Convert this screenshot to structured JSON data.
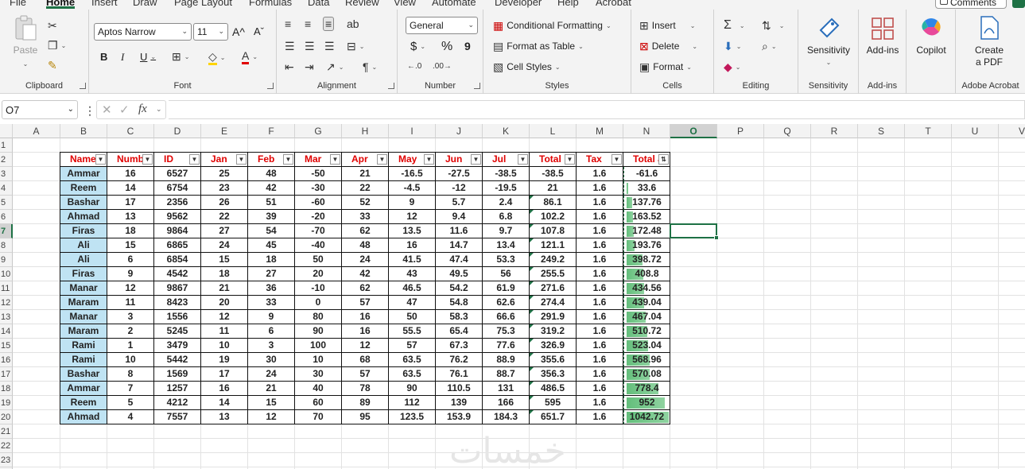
{
  "menu": {
    "tabs": [
      "File",
      "Home",
      "Insert",
      "Draw",
      "Page Layout",
      "Formulas",
      "Data",
      "Review",
      "View",
      "Automate",
      "Developer",
      "Help",
      "Acrobat"
    ],
    "active": "Home",
    "comments_label": "Comments"
  },
  "ribbon": {
    "clipboard": {
      "label": "Clipboard",
      "paste": "Paste"
    },
    "font": {
      "label": "Font",
      "family": "Aptos Narrow",
      "size": "11",
      "bold": "B",
      "italic": "I",
      "underline": "U",
      "grow": "A^",
      "shrink": "Aˇ"
    },
    "alignment": {
      "label": "Alignment"
    },
    "number": {
      "label": "Number",
      "format": "General",
      "currency": "$",
      "percent": "%",
      "comma": "9"
    },
    "styles": {
      "label": "Styles",
      "conditional": "Conditional Formatting",
      "format_table": "Format as Table",
      "cell_styles": "Cell Styles"
    },
    "cells": {
      "label": "Cells",
      "insert": "Insert",
      "delete": "Delete",
      "format": "Format"
    },
    "editing": {
      "label": "Editing"
    },
    "sensitivity": {
      "label": "Sensitivity",
      "button": "Sensitivity"
    },
    "addins": {
      "label": "Add-ins",
      "button": "Add-ins"
    },
    "copilot": {
      "button": "Copilot"
    },
    "acrobat": {
      "label": "Adobe Acrobat",
      "button_line1": "Create",
      "button_line2": "a PDF"
    }
  },
  "formula_bar": {
    "name_box": "O7",
    "fx": "fx",
    "content": ""
  },
  "columns": [
    "A",
    "B",
    "C",
    "D",
    "E",
    "F",
    "G",
    "H",
    "I",
    "J",
    "K",
    "L",
    "M",
    "N",
    "O",
    "P",
    "Q",
    "R",
    "S",
    "T",
    "U",
    "V"
  ],
  "selected_column": "O",
  "selected_row": 7,
  "table": {
    "headers": [
      "Name",
      "Numb",
      "ID",
      "Jan",
      "Feb",
      "Mar",
      "Apr",
      "May",
      "Jun",
      "Jul",
      "Total",
      "Tax",
      "Total af"
    ],
    "rows": [
      [
        "Ammar",
        "16",
        "6527",
        "25",
        "48",
        "-50",
        "21",
        "-16.5",
        "-27.5",
        "-38.5",
        "-38.5",
        "1.6",
        "-61.6"
      ],
      [
        "Reem",
        "14",
        "6754",
        "23",
        "42",
        "-30",
        "22",
        "-4.5",
        "-12",
        "-19.5",
        "21",
        "1.6",
        "33.6"
      ],
      [
        "Bashar",
        "17",
        "2356",
        "26",
        "51",
        "-60",
        "52",
        "9",
        "5.7",
        "2.4",
        "86.1",
        "1.6",
        "137.76"
      ],
      [
        "Ahmad",
        "13",
        "9562",
        "22",
        "39",
        "-20",
        "33",
        "12",
        "9.4",
        "6.8",
        "102.2",
        "1.6",
        "163.52"
      ],
      [
        "Firas",
        "18",
        "9864",
        "27",
        "54",
        "-70",
        "62",
        "13.5",
        "11.6",
        "9.7",
        "107.8",
        "1.6",
        "172.48"
      ],
      [
        "Ali",
        "15",
        "6865",
        "24",
        "45",
        "-40",
        "48",
        "16",
        "14.7",
        "13.4",
        "121.1",
        "1.6",
        "193.76"
      ],
      [
        "Ali",
        "6",
        "6854",
        "15",
        "18",
        "50",
        "24",
        "41.5",
        "47.4",
        "53.3",
        "249.2",
        "1.6",
        "398.72"
      ],
      [
        "Firas",
        "9",
        "4542",
        "18",
        "27",
        "20",
        "42",
        "43",
        "49.5",
        "56",
        "255.5",
        "1.6",
        "408.8"
      ],
      [
        "Manar",
        "12",
        "9867",
        "21",
        "36",
        "-10",
        "62",
        "46.5",
        "54.2",
        "61.9",
        "271.6",
        "1.6",
        "434.56"
      ],
      [
        "Maram",
        "11",
        "8423",
        "20",
        "33",
        "0",
        "57",
        "47",
        "54.8",
        "62.6",
        "274.4",
        "1.6",
        "439.04"
      ],
      [
        "Manar",
        "3",
        "1556",
        "12",
        "9",
        "80",
        "16",
        "50",
        "58.3",
        "66.6",
        "291.9",
        "1.6",
        "467.04"
      ],
      [
        "Maram",
        "2",
        "5245",
        "11",
        "6",
        "90",
        "16",
        "55.5",
        "65.4",
        "75.3",
        "319.2",
        "1.6",
        "510.72"
      ],
      [
        "Rami",
        "1",
        "3479",
        "10",
        "3",
        "100",
        "12",
        "57",
        "67.3",
        "77.6",
        "326.9",
        "1.6",
        "523.04"
      ],
      [
        "Rami",
        "10",
        "5442",
        "19",
        "30",
        "10",
        "68",
        "63.5",
        "76.2",
        "88.9",
        "355.6",
        "1.6",
        "568.96"
      ],
      [
        "Bashar",
        "8",
        "1569",
        "17",
        "24",
        "30",
        "57",
        "63.5",
        "76.1",
        "88.7",
        "356.3",
        "1.6",
        "570.08"
      ],
      [
        "Ammar",
        "7",
        "1257",
        "16",
        "21",
        "40",
        "78",
        "90",
        "110.5",
        "131",
        "486.5",
        "1.6",
        "778.4"
      ],
      [
        "Reem",
        "5",
        "4212",
        "14",
        "15",
        "60",
        "89",
        "112",
        "139",
        "166",
        "595",
        "1.6",
        "952"
      ],
      [
        "Ahmad",
        "4",
        "7557",
        "13",
        "12",
        "70",
        "95",
        "123.5",
        "153.9",
        "184.3",
        "651.7",
        "1.6",
        "1042.72"
      ]
    ],
    "databar_max": 1042.72
  },
  "watermark": "خمسات",
  "colors": {
    "accent": "#1e7145",
    "header_text": "#e00000",
    "name_fill": "#bfe3f3",
    "databar": "#63be7b"
  }
}
